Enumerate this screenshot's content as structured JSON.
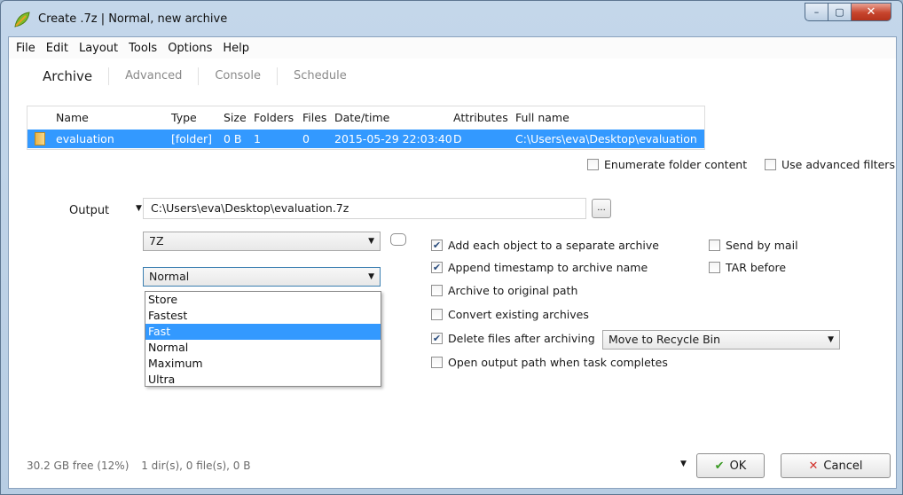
{
  "window": {
    "title": "Create .7z | Normal, new archive",
    "caption_buttons": {
      "minimize": "–",
      "maximize": "▢",
      "close": "✕"
    }
  },
  "menu": [
    "File",
    "Edit",
    "Layout",
    "Tools",
    "Options",
    "Help"
  ],
  "tabs": [
    "Archive",
    "Advanced",
    "Console",
    "Schedule"
  ],
  "file_list": {
    "columns": [
      "Name",
      "Type",
      "Size",
      "Folders",
      "Files",
      "Date/time",
      "Attributes",
      "Full name"
    ],
    "rows": [
      {
        "name": "evaluation",
        "type": "[folder]",
        "size": "0 B",
        "folders": "1",
        "files": "0",
        "datetime": "2015-05-29 22:03:40",
        "attributes": "D",
        "full_name": "C:\\Users\\eva\\Desktop\\evaluation"
      }
    ]
  },
  "list_options": {
    "enumerate": {
      "label": "Enumerate folder content",
      "checked": false
    },
    "advanced_filters": {
      "label": "Use advanced filters",
      "checked": false
    }
  },
  "output": {
    "label": "Output",
    "path": "C:\\Users\\eva\\Desktop\\evaluation.7z",
    "browse": "..."
  },
  "format": {
    "selected": "7Z"
  },
  "compression": {
    "selected": "Normal",
    "options": [
      "Store",
      "Fastest",
      "Fast",
      "Normal",
      "Maximum",
      "Ultra"
    ],
    "highlighted": "Fast"
  },
  "options": {
    "separate_archive": {
      "label": "Add each object to a separate archive",
      "checked": true
    },
    "timestamp": {
      "label": "Append timestamp to archive name",
      "checked": true
    },
    "original_path": {
      "label": "Archive to original path",
      "checked": false
    },
    "convert": {
      "label": "Convert existing archives",
      "checked": false
    },
    "delete_files": {
      "label": "Delete files after archiving",
      "checked": true
    },
    "open_output": {
      "label": "Open output path when task completes",
      "checked": false
    },
    "send_mail": {
      "label": "Send by mail",
      "checked": false
    },
    "tar_before": {
      "label": "TAR before",
      "checked": false
    }
  },
  "delete_mode": {
    "selected": "Move to Recycle Bin"
  },
  "status": {
    "free": "30.2 GB free (12%)",
    "summary": "1 dir(s), 0 file(s), 0 B"
  },
  "buttons": {
    "ok": "OK",
    "cancel": "Cancel"
  },
  "colors": {
    "selection": "#3399ff",
    "ok_check": "#3a9a24",
    "cancel_x": "#d2302a"
  }
}
